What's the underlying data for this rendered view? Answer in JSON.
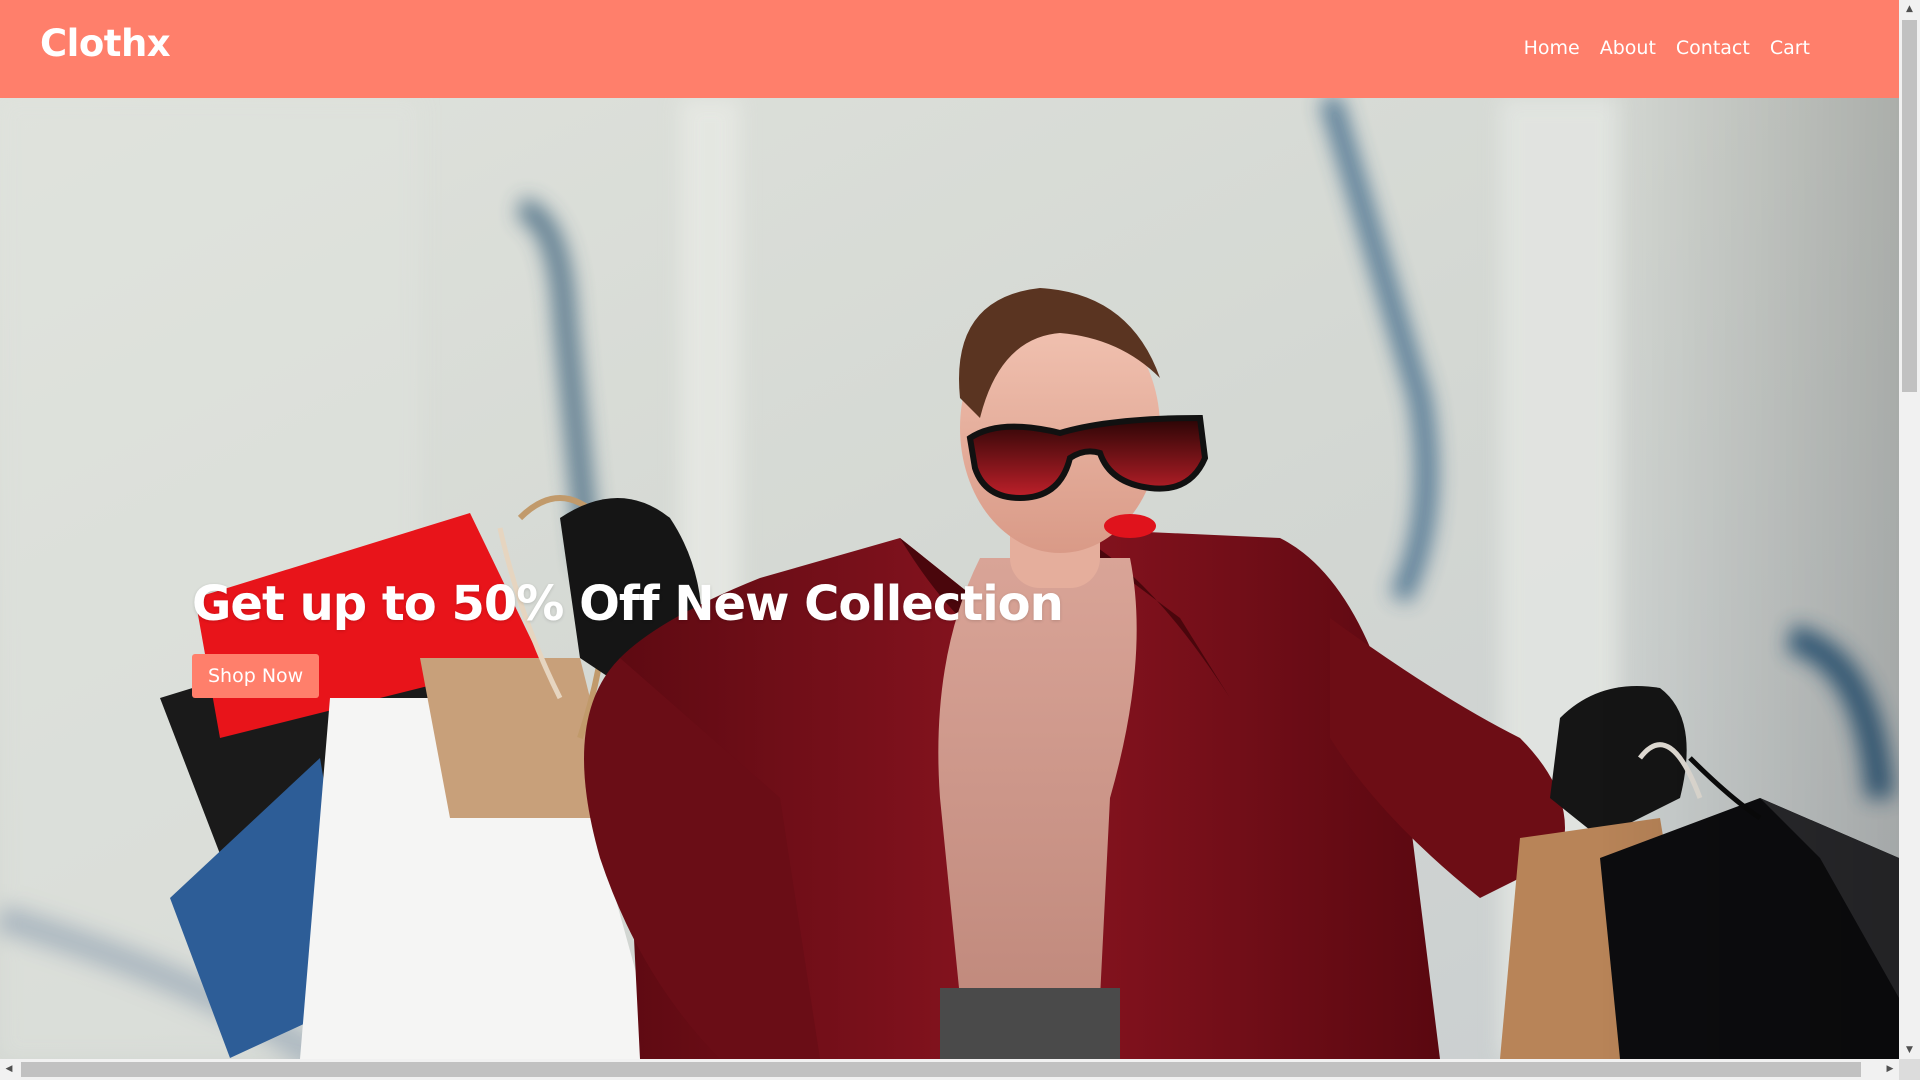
{
  "brand": {
    "name": "Clothx"
  },
  "nav": {
    "items": [
      {
        "label": "Home"
      },
      {
        "label": "About"
      },
      {
        "label": "Contact"
      },
      {
        "label": "Cart"
      }
    ]
  },
  "hero": {
    "title": "Get up to 50% Off New Collection",
    "button_label": "Shop Now",
    "image_subject": "woman-with-shopping-bags-photo"
  },
  "scrollbars": {
    "vertical_arrow_up": "▲",
    "vertical_arrow_down": "▼",
    "horizontal_arrow_left": "◀",
    "horizontal_arrow_right": "▶"
  },
  "colors": {
    "accent": "#ff7f6b",
    "text_on_accent": "#ffffff",
    "coat": "#7a1018",
    "glove": "#151515"
  }
}
